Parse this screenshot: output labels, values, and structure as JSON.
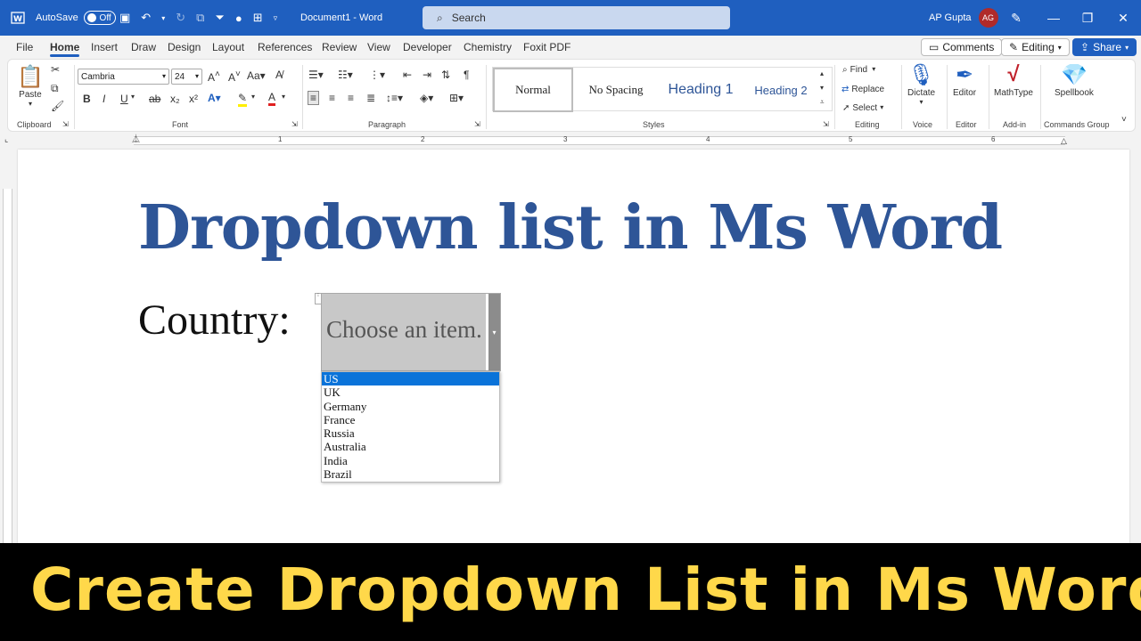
{
  "titlebar": {
    "autosave_label": "AutoSave",
    "autosave_state": "Off",
    "doc_title": "Document1  -  Word",
    "search_placeholder": "Search",
    "user_name": "AP Gupta",
    "user_initials": "AG"
  },
  "menu": {
    "tabs": [
      "File",
      "Home",
      "Insert",
      "Draw",
      "Design",
      "Layout",
      "References",
      "Review",
      "View",
      "Developer",
      "Chemistry",
      "Foxit PDF"
    ],
    "comments_label": "Comments",
    "editing_label": "Editing",
    "share_label": "Share"
  },
  "ribbon": {
    "clipboard": {
      "paste_label": "Paste",
      "group_label": "Clipboard"
    },
    "font": {
      "font_name": "Cambria",
      "font_size": "24",
      "group_label": "Font"
    },
    "paragraph": {
      "group_label": "Paragraph"
    },
    "styles": {
      "items": [
        "Normal",
        "No Spacing",
        "Heading 1",
        "Heading 2"
      ],
      "group_label": "Styles"
    },
    "editing": {
      "find_label": "Find",
      "replace_label": "Replace",
      "select_label": "Select",
      "group_label": "Editing"
    },
    "voice": {
      "dictate_label": "Dictate",
      "group_label": "Voice"
    },
    "editor": {
      "editor_label": "Editor",
      "group_label": "Editor"
    },
    "addin": {
      "mathtype_label": "MathType",
      "group_label": "Add-in"
    },
    "commands": {
      "spellbook_label": "Spellbook",
      "group_label": "Commands Group"
    }
  },
  "ruler": {
    "numbers": [
      "1",
      "2",
      "3",
      "4",
      "5",
      "6"
    ]
  },
  "document": {
    "title": "Dropdown list in Ms Word",
    "country_label": "Country:",
    "dropdown": {
      "placeholder": "Choose an item.",
      "options": [
        "US",
        "UK",
        "Germany",
        "France",
        "Russia",
        "Australia",
        "India",
        "Brazil"
      ],
      "highlighted": "US"
    }
  },
  "banner": {
    "text": "Create Dropdown List in Ms Word"
  },
  "colors": {
    "accent": "#1f5fbf",
    "title_blue": "#2e5597",
    "banner_yellow": "#ffd84a",
    "highlight": "#0a73d9"
  }
}
